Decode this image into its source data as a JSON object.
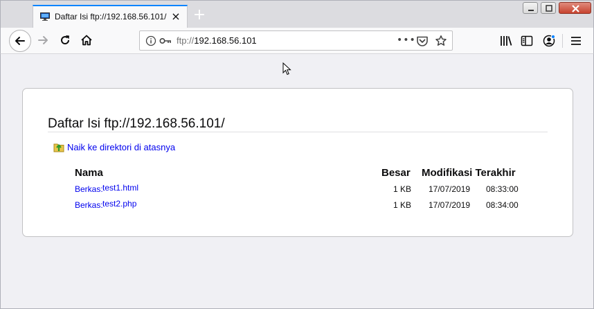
{
  "tab": {
    "title": "Daftar Isi ftp://192.168.56.101/",
    "close_glyph": "×"
  },
  "newtab_glyph": "+",
  "urlbar": {
    "scheme": "ftp://",
    "host": "192.168.56.101",
    "meatball": "•••"
  },
  "colors": {
    "accent": "#0a84ff",
    "link": "#0000ee",
    "background": "#f0f0f4"
  },
  "listing": {
    "heading": "Daftar Isi ftp://192.168.56.101/",
    "up_link": "Naik ke direktori di atasnya",
    "columns": {
      "name": "Nama",
      "size": "Besar",
      "modified": "Modifikasi Terakhir"
    },
    "rows": [
      {
        "prefix": "Berkas:",
        "name": "test1.html",
        "size": "1 KB",
        "date": "17/07/2019",
        "time": "08:33:00"
      },
      {
        "prefix": "Berkas:",
        "name": "test2.php",
        "size": "1 KB",
        "date": "17/07/2019",
        "time": "08:34:00"
      }
    ]
  },
  "icons": [
    "monitor-favicon-icon",
    "back-arrow-icon",
    "forward-arrow-icon",
    "reload-icon",
    "home-icon",
    "info-icon",
    "key-icon",
    "pocket-icon",
    "star-icon",
    "library-icon",
    "sidebar-icon",
    "account-icon",
    "hamburger-menu-icon",
    "folder-up-icon",
    "mouse-cursor-icon"
  ]
}
